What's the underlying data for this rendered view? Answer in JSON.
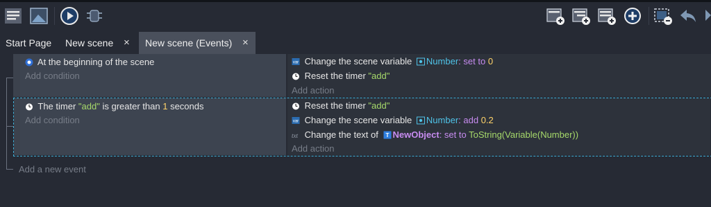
{
  "tabs": [
    {
      "label": "Start Page"
    },
    {
      "label": "New scene"
    },
    {
      "label": "New scene (Events)"
    }
  ],
  "tab_close_glyph": "×",
  "toolbar": {
    "left_icons": [
      "project-manager-icon",
      "scene-editor-icon",
      "preview-play-icon",
      "debug-icon"
    ],
    "right_icons": [
      "add-event-icon",
      "add-subevent-icon",
      "add-other-event-icon",
      "add-plus-icon",
      "delete-event-icon",
      "undo-icon"
    ]
  },
  "events": [
    {
      "conditions": [
        "At the beginning of the scene"
      ],
      "add_condition": "Add condition",
      "actions": [
        {
          "prefix": "Change the scene variable",
          "var": "Number",
          "op": ": set to",
          "value": "0"
        },
        {
          "prefix": "Reset the timer",
          "value": "\"add\""
        }
      ],
      "add_action": "Add action"
    },
    {
      "conditions": [
        {
          "prefix": "The timer",
          "timer": "\"add\"",
          "middle": "is greater than",
          "amount": "1",
          "suffix": "seconds"
        }
      ],
      "add_condition": "Add condition",
      "actions": [
        {
          "prefix": "Reset the timer",
          "value": "\"add\""
        },
        {
          "prefix": "Change the scene variable",
          "var": "Number",
          "op": ": add",
          "value": "0.2"
        },
        {
          "prefix": "Change the text of",
          "object": "NewObject",
          "op": ": set to",
          "value": "ToString(Variable(Number))"
        }
      ],
      "add_action": "Add action"
    }
  ],
  "add_event": "Add a new event",
  "colors": {
    "accent": "#3fb0d8",
    "active_tab": "#4a505c",
    "string": "#a6d96a",
    "number": "#ffd36a",
    "keyword": "#c78cf0",
    "variable": "#4fc3e8"
  }
}
